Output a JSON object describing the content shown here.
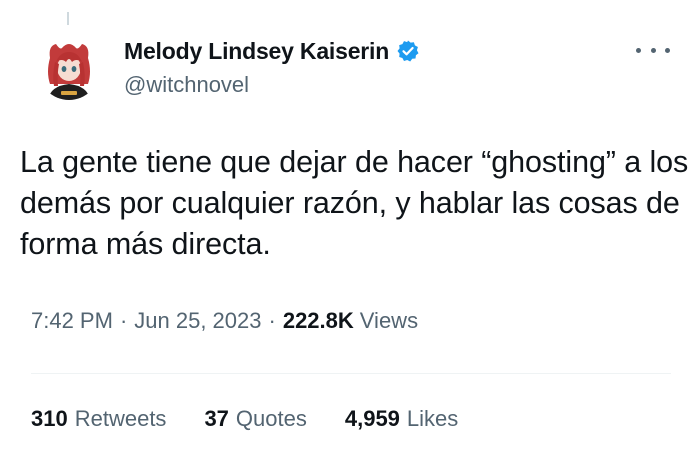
{
  "tweet": {
    "author": {
      "display_name": "Melody Lindsey Kaiserin",
      "handle": "@witchnovel",
      "verified": true,
      "avatar_icon": "anime-avatar-red-hair"
    },
    "text": "La gente tiene que dejar de hacer “ghosting” a los demás por cualquier razón, y hablar las cosas de forma más directa.",
    "meta": {
      "time": "7:42 PM",
      "separator": "·",
      "date": "Jun 25, 2023",
      "views_count": "222.8K",
      "views_label": "Views"
    },
    "stats": [
      {
        "count": "310",
        "label": "Retweets"
      },
      {
        "count": "37",
        "label": "Quotes"
      },
      {
        "count": "4,959",
        "label": "Likes"
      }
    ]
  },
  "colors": {
    "text_primary": "#0f1419",
    "text_secondary": "#536471",
    "verified_blue": "#1d9bf0",
    "divider": "#eff3f4"
  },
  "icons": {
    "more": "more-horizontal-icon",
    "verified": "verified-badge-icon"
  }
}
